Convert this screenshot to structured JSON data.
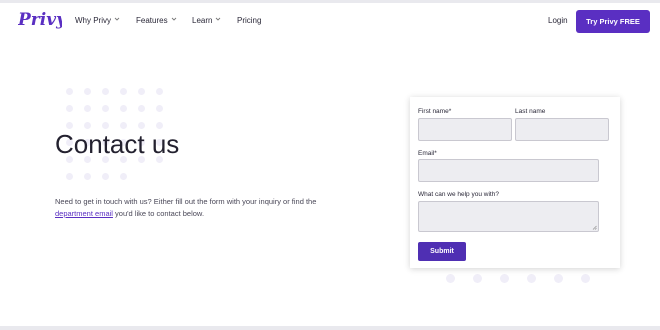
{
  "brand": {
    "logo_text": "Privy",
    "color": "#5a2fc2"
  },
  "nav": {
    "items": [
      {
        "label": "Why Privy",
        "has_dropdown": true
      },
      {
        "label": "Features",
        "has_dropdown": true
      },
      {
        "label": "Learn",
        "has_dropdown": true
      },
      {
        "label": "Pricing",
        "has_dropdown": false
      }
    ],
    "login_label": "Login",
    "cta_label": "Try Privy FREE"
  },
  "hero": {
    "title": "Contact us",
    "desc_before": "Need to get in touch with us? Either fill out the form with your inquiry or find the ",
    "desc_link": "department email",
    "desc_after": " you'd like to contact below."
  },
  "form": {
    "first_name_label": "First name*",
    "last_name_label": "Last name",
    "email_label": "Email*",
    "message_label": "What can we help you with?",
    "first_name_value": "",
    "last_name_value": "",
    "email_value": "",
    "message_value": "",
    "submit_label": "Submit"
  }
}
